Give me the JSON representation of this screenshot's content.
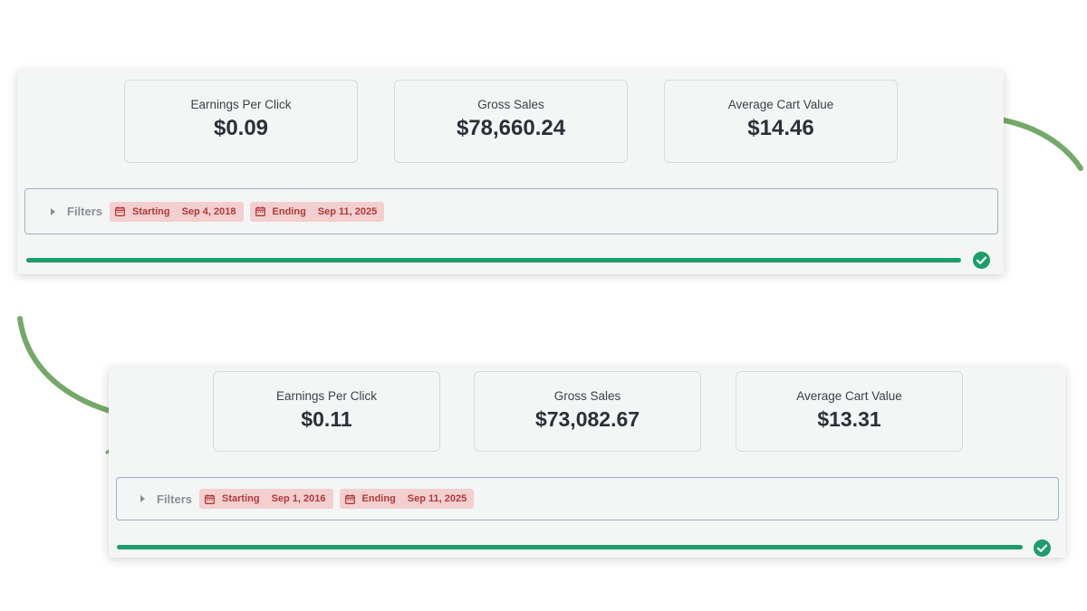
{
  "colors": {
    "accent_green": "#1c9d6c",
    "chip_bg": "#f3cfcf",
    "chip_text": "#b13a3a",
    "arrow": "#74a968"
  },
  "panels": [
    {
      "metrics": [
        {
          "label": "Earnings Per Click",
          "value": "$0.09"
        },
        {
          "label": "Gross Sales",
          "value": "$78,660.24"
        },
        {
          "label": "Average Cart Value",
          "value": "$14.46"
        }
      ],
      "filters": {
        "label": "Filters",
        "start_key": "Starting",
        "start_value": "Sep 4, 2018",
        "end_key": "Ending",
        "end_value": "Sep 11, 2025"
      },
      "progress": 1.0
    },
    {
      "metrics": [
        {
          "label": "Earnings Per Click",
          "value": "$0.11"
        },
        {
          "label": "Gross Sales",
          "value": "$73,082.67"
        },
        {
          "label": "Average Cart Value",
          "value": "$13.31"
        }
      ],
      "filters": {
        "label": "Filters",
        "start_key": "Starting",
        "start_value": "Sep 1, 2016",
        "end_key": "Ending",
        "end_value": "Sep 11, 2025"
      },
      "progress": 1.0
    }
  ],
  "icons": {
    "calendar": "calendar-icon",
    "check": "check-circle-icon",
    "caret": "caret-right-icon",
    "arrow": "curved-arrow-icon"
  }
}
